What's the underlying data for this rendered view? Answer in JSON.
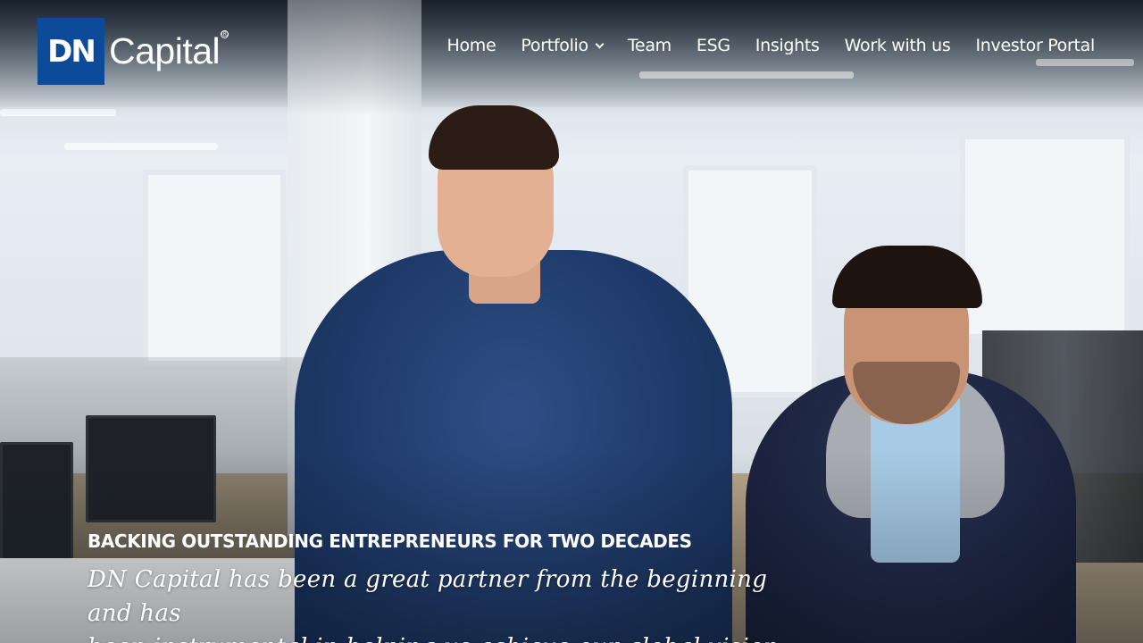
{
  "brand": {
    "logo_mark": "DN",
    "logo_word": "Capital",
    "logo_registered": "®",
    "color": "#0d4a99"
  },
  "nav": {
    "items": [
      {
        "label": "Home"
      },
      {
        "label": "Portfolio",
        "has_dropdown": true,
        "icon": "chevron-down-icon"
      },
      {
        "label": "Team"
      },
      {
        "label": "ESG"
      },
      {
        "label": "Insights"
      },
      {
        "label": "Work with us"
      },
      {
        "label": "Investor Portal"
      }
    ]
  },
  "hero": {
    "tagline": "BACKING OUTSTANDING ENTREPRENEURS FOR TWO DECADES",
    "quote_line1": "DN Capital has been a great partner from the beginning and has",
    "quote_line2": "been instrumental in helping us achieve our global vision."
  }
}
